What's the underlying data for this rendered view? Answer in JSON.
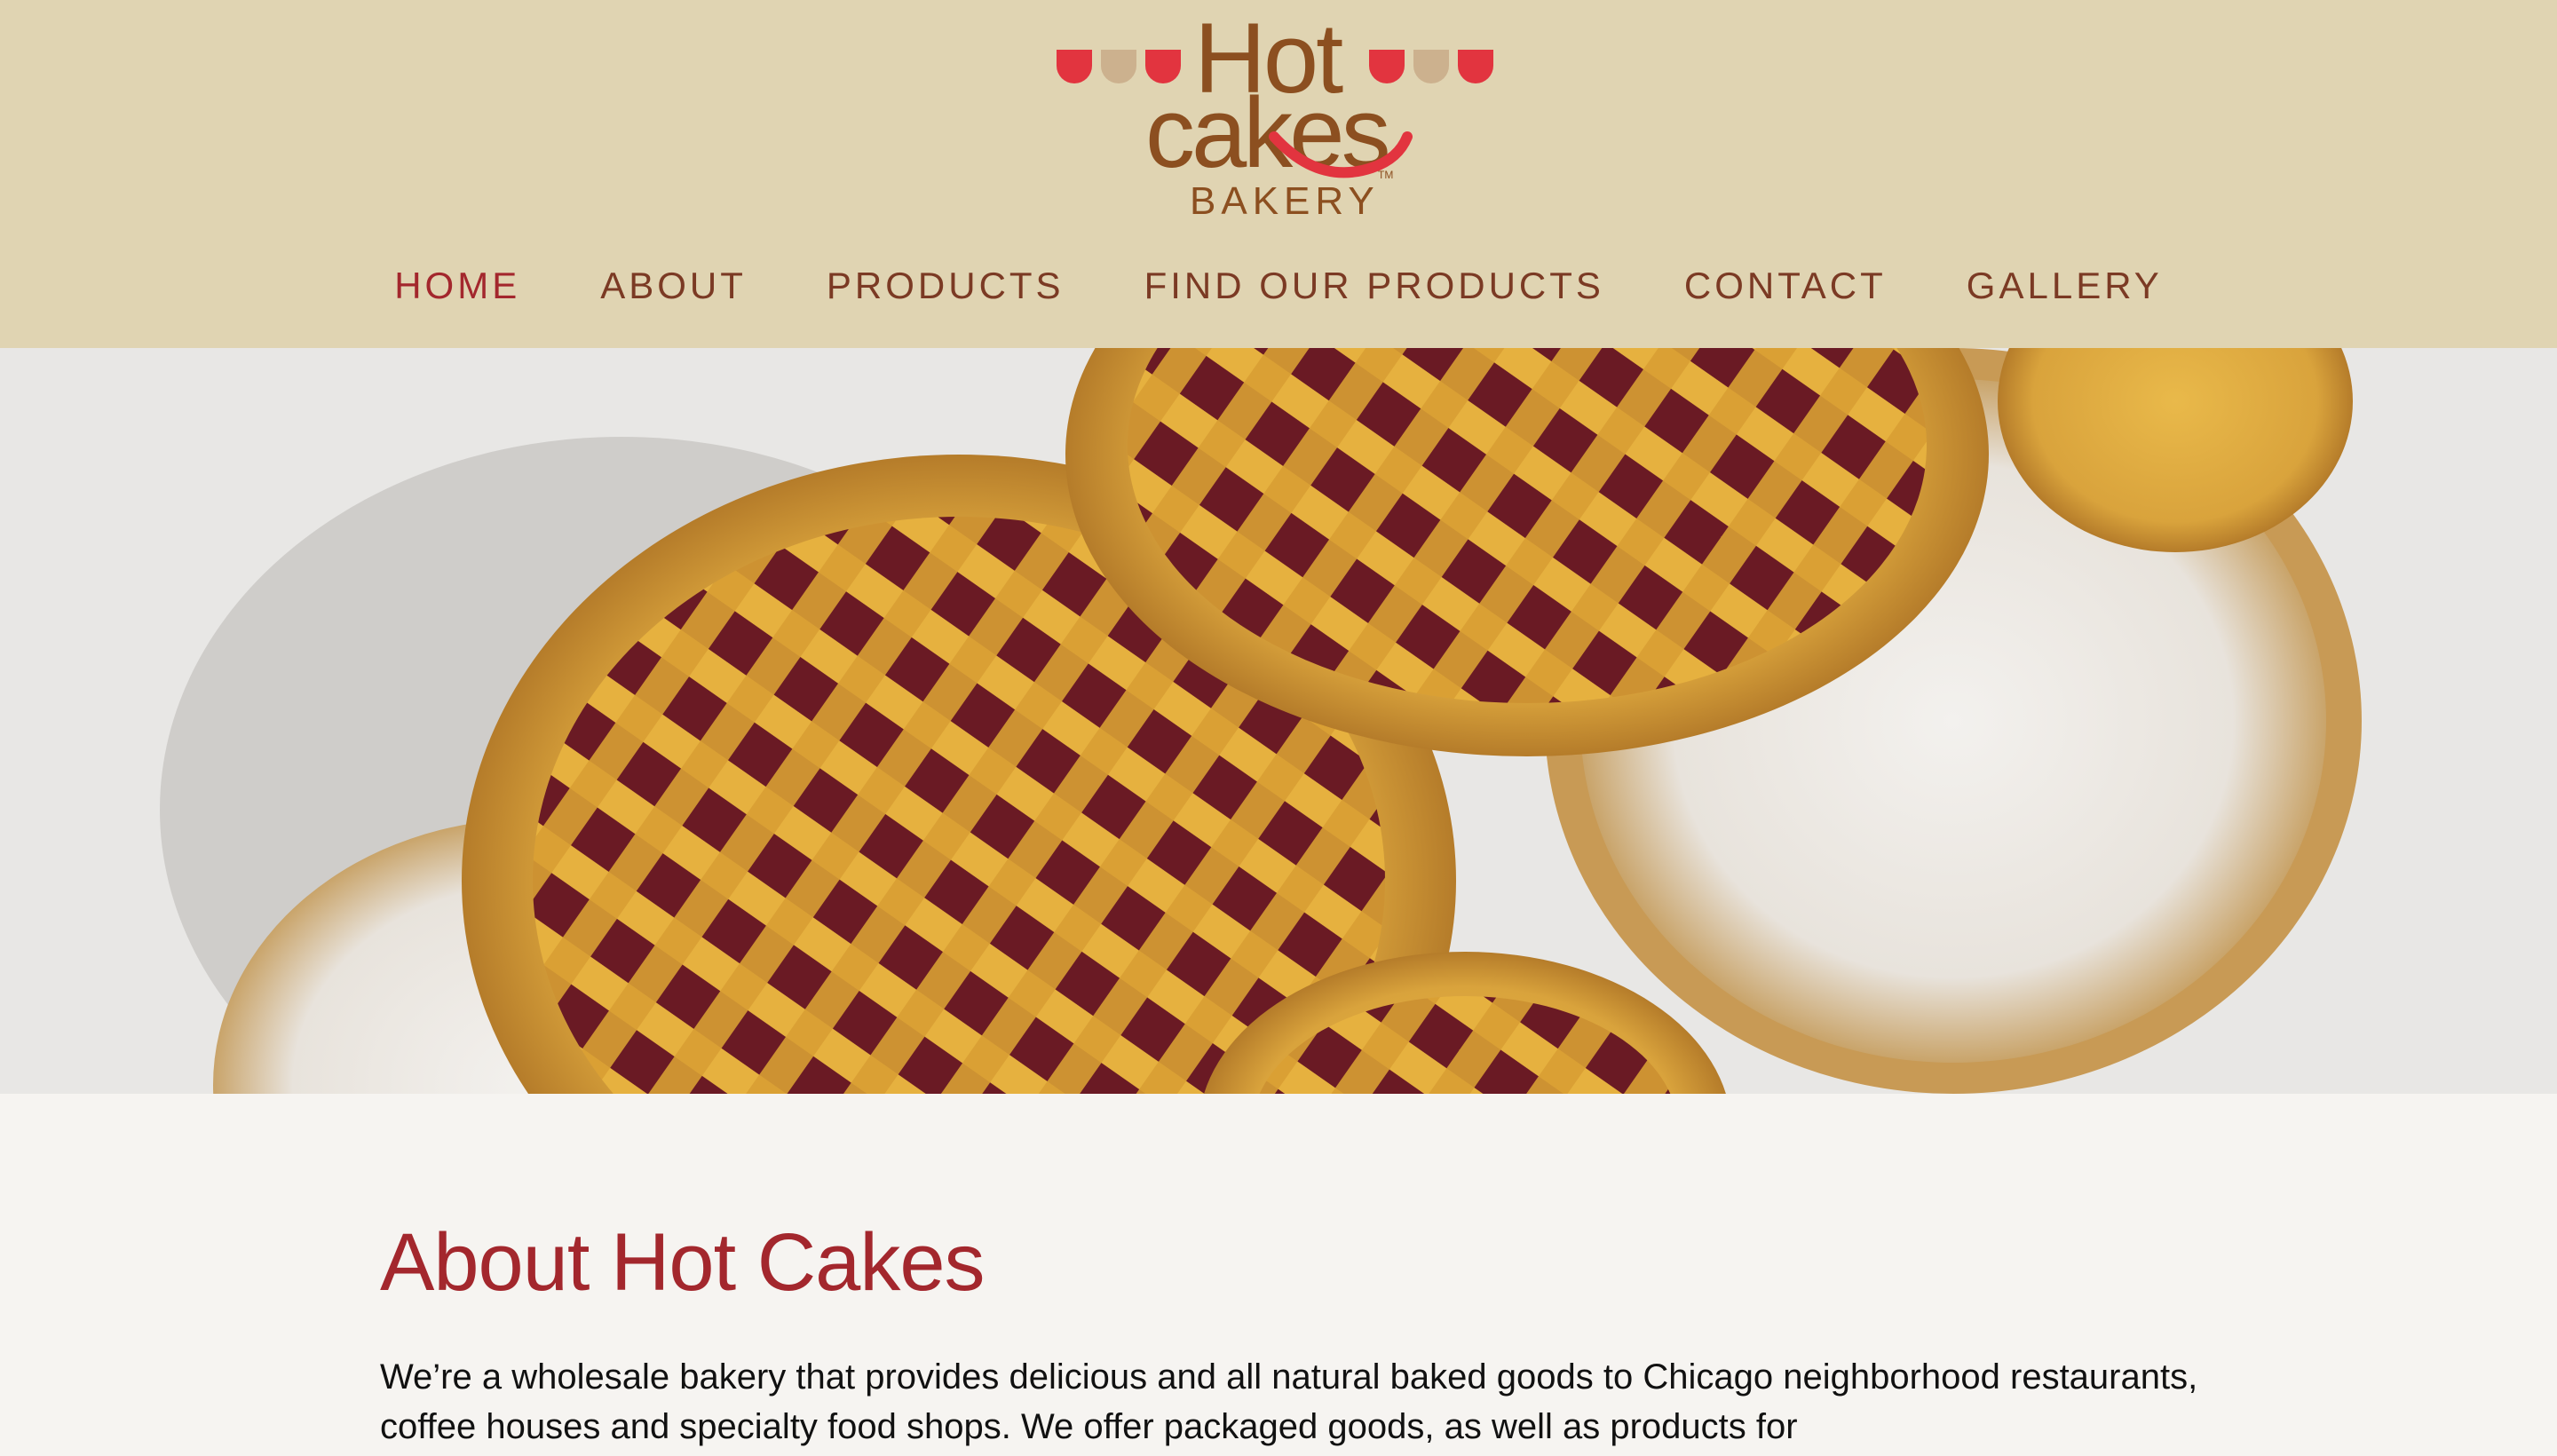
{
  "brand": {
    "logo_text_top": "Hot",
    "logo_text_middle": "cakes",
    "logo_text_bottom": "BAKERY",
    "logo_tm": "TM",
    "colors": {
      "header_bg": "#e0d4b2",
      "accent_red": "#a3272d",
      "logo_brown": "#8c4f20",
      "cup_red": "#e2343f",
      "cup_tan": "#ccb18e"
    }
  },
  "nav": {
    "items": [
      {
        "label": "HOME",
        "active": true
      },
      {
        "label": "ABOUT",
        "active": false
      },
      {
        "label": "PRODUCTS",
        "active": false
      },
      {
        "label": "FIND OUR PRODUCTS",
        "active": false
      },
      {
        "label": "CONTACT",
        "active": false
      },
      {
        "label": "GALLERY",
        "active": false
      }
    ]
  },
  "hero": {
    "image_subject": "lattice jam tarts and powdered sugar tarts"
  },
  "about": {
    "title": "About Hot Cakes",
    "paragraph": "We’re a wholesale bakery that provides delicious and all natural baked goods to Chicago neighborhood restaurants, coffee houses and specialty food shops. We offer packaged goods, as well as products for"
  }
}
